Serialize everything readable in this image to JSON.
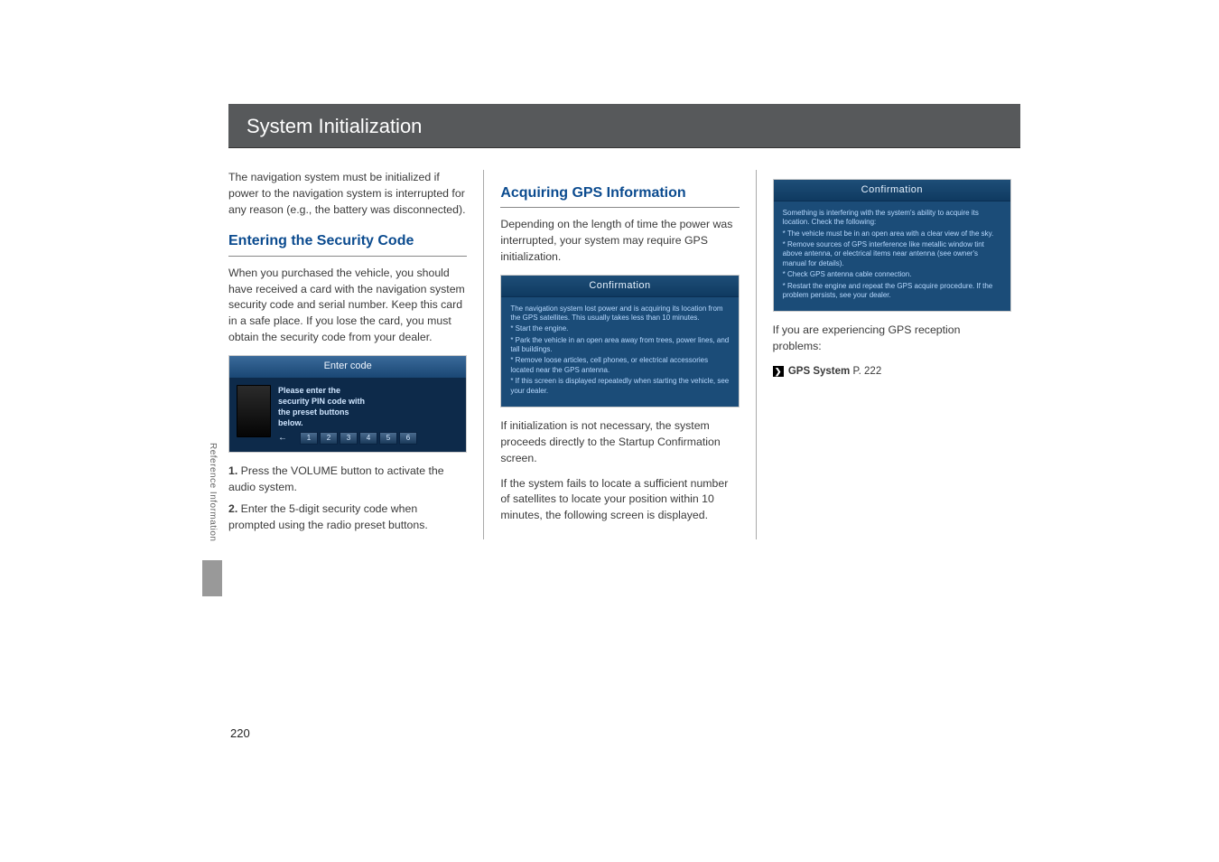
{
  "page": {
    "header": "System Initialization",
    "side_label": "Reference Information",
    "page_number": "220"
  },
  "col1": {
    "intro": "The navigation system must be initialized if power to the navigation system is interrupted for any reason (e.g., the battery was disconnected).",
    "heading": "Entering the Security Code",
    "para1": "When you purchased the vehicle, you should have received a card with the navigation system security code and serial number. Keep this card in a safe place. If you lose the card, you must obtain the security code from your dealer.",
    "enter_code": {
      "title": "Enter code",
      "line1": "Please enter the",
      "line2": "security PIN code with",
      "line3": "the preset buttons",
      "line4": "below.",
      "buttons": [
        "1",
        "2",
        "3",
        "4",
        "5",
        "6"
      ]
    },
    "step1_num": "1.",
    "step1_text": " Press the VOLUME button to activate the audio system.",
    "step2_num": "2.",
    "step2_text": " Enter the 5-digit security code when prompted using the radio preset buttons."
  },
  "col2": {
    "heading": "Acquiring GPS Information",
    "para1": "Depending on the length of time the power was interrupted, your system may require GPS initialization.",
    "confirm1": {
      "title": "Confirmation",
      "l1": "The navigation system lost power and is acquiring its location from the GPS satellites. This usually takes less than 10 minutes.",
      "l2": "* Start the engine.",
      "l3": "* Park the vehicle in an open area away from trees, power lines, and tall buildings.",
      "l4": "* Remove loose articles, cell phones, or electrical accessories located near the GPS antenna.",
      "l5": "* If this screen is displayed repeatedly when starting the vehicle, see your dealer."
    },
    "para2": "If initialization is not necessary, the system proceeds directly to the Startup Confirmation screen.",
    "para3": "If the system fails to locate a sufficient number of satellites to locate your position within 10 minutes, the following screen is displayed."
  },
  "col3": {
    "confirm2": {
      "title": "Confirmation",
      "l1": "Something is interfering with the system's ability to acquire its location. Check the following:",
      "l2": "* The vehicle must be in an open area with a clear view of the sky.",
      "l3": "* Remove sources of GPS interference like metallic window tint above antenna, or electrical items near antenna (see owner's manual for details).",
      "l4": "* Check GPS antenna cable connection.",
      "l5": "* Restart the engine and repeat the GPS acquire procedure. If the problem persists, see your dealer."
    },
    "para1": "If you are experiencing GPS reception problems:",
    "link_label": "GPS System",
    "link_page": " P. 222"
  }
}
